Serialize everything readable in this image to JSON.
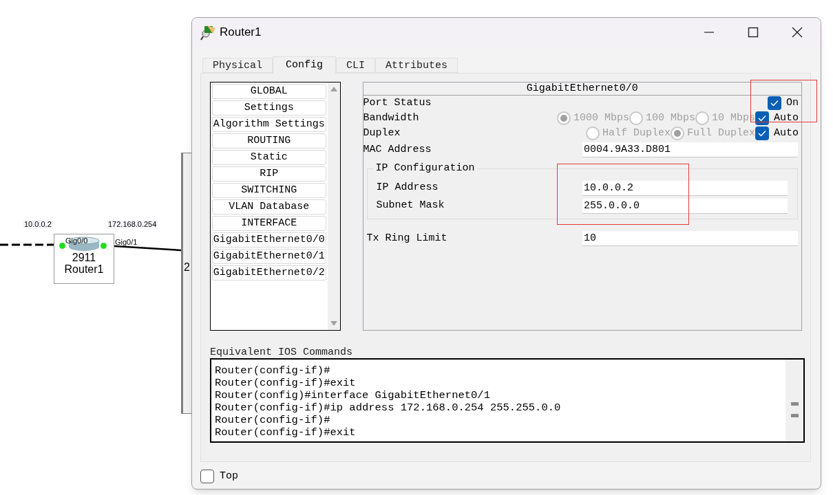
{
  "topology": {
    "device": {
      "model": "2911",
      "name": "Router1"
    },
    "ports": [
      {
        "label": "Gig0/0",
        "address": "10.0.0.2",
        "kind": "dashed"
      },
      {
        "label": "Gig0/1",
        "address": "172.168.0.254",
        "kind": "solid"
      }
    ],
    "partial_label": "2"
  },
  "window": {
    "title": "Router1"
  },
  "tabs": [
    {
      "label": "Physical",
      "selected": false
    },
    {
      "label": "Config",
      "selected": true
    },
    {
      "label": "CLI",
      "selected": false
    },
    {
      "label": "Attributes",
      "selected": false
    }
  ],
  "sidebar": {
    "items": [
      {
        "label": "GLOBAL",
        "selected": false
      },
      {
        "label": "Settings",
        "selected": false
      },
      {
        "label": "Algorithm Settings",
        "selected": false
      },
      {
        "label": "ROUTING",
        "selected": false
      },
      {
        "label": "Static",
        "selected": false
      },
      {
        "label": "RIP",
        "selected": false
      },
      {
        "label": "SWITCHING",
        "selected": false
      },
      {
        "label": "VLAN Database",
        "selected": false
      },
      {
        "label": "INTERFACE",
        "selected": false
      },
      {
        "label": "GigabitEthernet0/0",
        "selected": false
      },
      {
        "label": "GigabitEthernet0/1",
        "selected": false
      },
      {
        "label": "GigabitEthernet0/2",
        "selected": false
      }
    ]
  },
  "interface": {
    "title": "GigabitEthernet0/0",
    "port_status": {
      "label": "Port Status",
      "toggle": {
        "label": "On",
        "checked": true
      }
    },
    "bandwidth": {
      "label": "Bandwidth",
      "options": [
        {
          "label": "1000 Mbps",
          "selected": true
        },
        {
          "label": "100 Mbps",
          "selected": false
        },
        {
          "label": "10 Mbps",
          "selected": false
        }
      ],
      "disabled": true,
      "auto": {
        "label": "Auto",
        "checked": true
      }
    },
    "duplex": {
      "label": "Duplex",
      "options": [
        {
          "label": "Half Duplex",
          "selected": false
        },
        {
          "label": "Full Duplex",
          "selected": true
        }
      ],
      "disabled": true,
      "auto": {
        "label": "Auto",
        "checked": true
      }
    },
    "mac_address": {
      "label": "MAC Address",
      "value": "0004.9A33.D801"
    },
    "ip_configuration": {
      "title": "IP Configuration",
      "fields": [
        {
          "label": "IP Address",
          "value": "10.0.0.2"
        },
        {
          "label": "Subnet Mask",
          "value": "255.0.0.0"
        }
      ]
    },
    "tx_ring_limit": {
      "label": "Tx Ring Limit",
      "value": "10"
    }
  },
  "ios_commands": {
    "title": "Equivalent IOS Commands",
    "lines": [
      "Router(config-if)#",
      "Router(config-if)#exit",
      "Router(config)#interface GigabitEthernet0/1",
      "Router(config-if)#ip address 172.168.0.254 255.255.0.0",
      "Router(config-if)#",
      "Router(config-if)#exit"
    ]
  },
  "top_option": {
    "label": "Top",
    "checked": false
  }
}
